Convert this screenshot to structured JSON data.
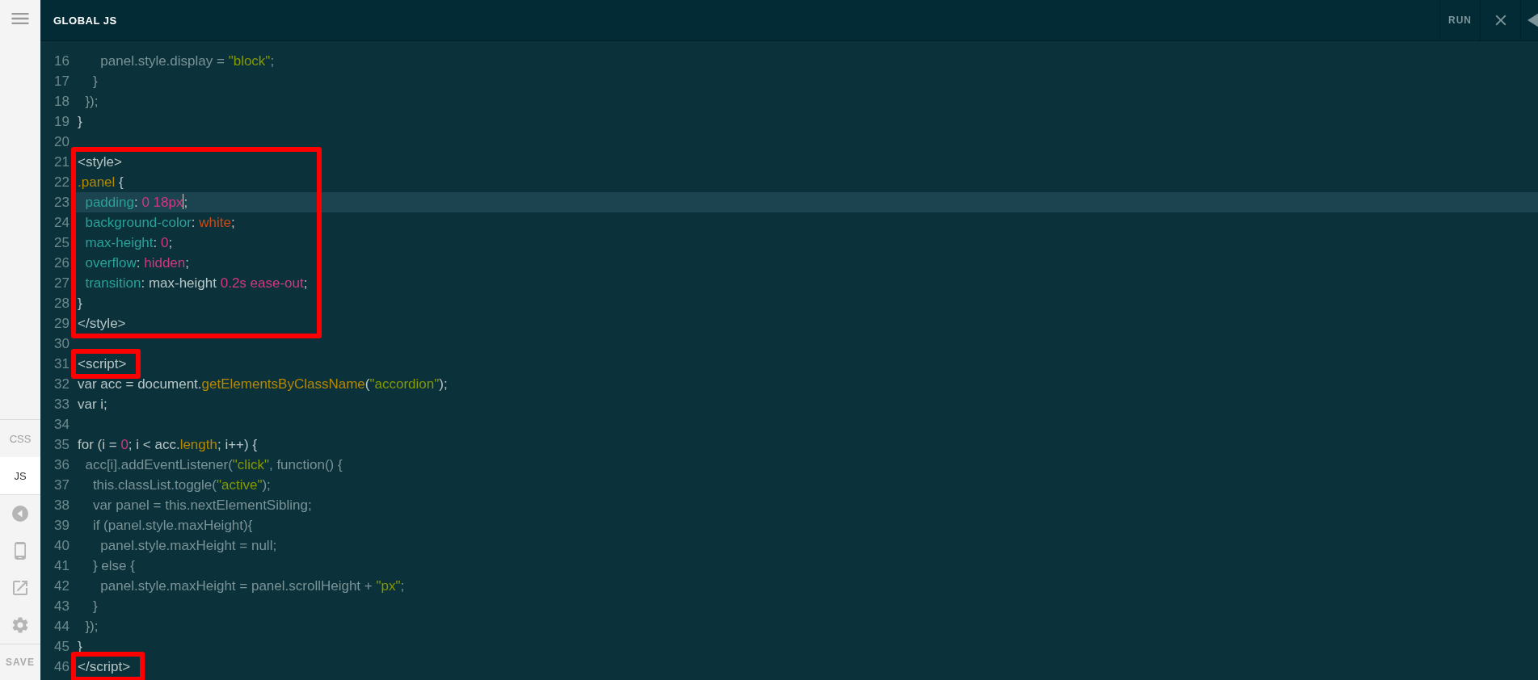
{
  "header": {
    "title": "GLOBAL JS",
    "run_label": "RUN"
  },
  "sidebar": {
    "tabs": [
      {
        "label": "CSS",
        "selected": false
      },
      {
        "label": "JS",
        "selected": true
      }
    ],
    "save_label": "SAVE"
  },
  "editor": {
    "blocks": [
      {
        "boxed": false,
        "lines": [
          {
            "number": "16",
            "active": false,
            "tokens": [
              {
                "t": "      panel.style.display = ",
                "kind": "dim"
              },
              {
                "t": "\"block\"",
                "kind": "string"
              },
              {
                "t": ";",
                "kind": "dim"
              }
            ]
          },
          {
            "number": "17",
            "active": false,
            "tokens": [
              {
                "t": "    }",
                "kind": "dim"
              }
            ]
          },
          {
            "number": "18",
            "active": false,
            "tokens": [
              {
                "t": "  });",
                "kind": "dim"
              }
            ]
          },
          {
            "number": "19",
            "active": false,
            "tokens": [
              {
                "t": "}",
                "kind": "light"
              }
            ]
          },
          {
            "number": "20",
            "active": false
          }
        ]
      },
      {
        "boxed": true,
        "lines": [
          {
            "number": "21",
            "active": false,
            "tokens": [
              {
                "t": "<style>",
                "kind": "light"
              }
            ]
          },
          {
            "number": "22",
            "active": false,
            "tokens": [
              {
                "t": ".panel",
                "kind": "func"
              },
              {
                "t": " {",
                "kind": "light"
              }
            ]
          },
          {
            "number": "23",
            "active": true,
            "tokens": [
              {
                "t": "  padding",
                "kind": "prop"
              },
              {
                "t": ": ",
                "kind": "light"
              },
              {
                "t": "0 18px",
                "kind": "value",
                "caret": true
              },
              {
                "t": ";",
                "kind": "light"
              }
            ]
          },
          {
            "number": "24",
            "active": false,
            "tokens": [
              {
                "t": "  background-color",
                "kind": "prop"
              },
              {
                "t": ": ",
                "kind": "light"
              },
              {
                "t": "white",
                "kind": "keyword"
              },
              {
                "t": ";",
                "kind": "light"
              }
            ]
          },
          {
            "number": "25",
            "active": false,
            "tokens": [
              {
                "t": "  max-height",
                "kind": "prop"
              },
              {
                "t": ": ",
                "kind": "light"
              },
              {
                "t": "0",
                "kind": "value"
              },
              {
                "t": ";",
                "kind": "light"
              }
            ]
          },
          {
            "number": "26",
            "active": false,
            "tokens": [
              {
                "t": "  overflow",
                "kind": "prop"
              },
              {
                "t": ": ",
                "kind": "light"
              },
              {
                "t": "hidden",
                "kind": "value"
              },
              {
                "t": ";",
                "kind": "light"
              }
            ]
          },
          {
            "number": "27",
            "active": false,
            "tokens": [
              {
                "t": "  transition",
                "kind": "prop"
              },
              {
                "t": ": max-height ",
                "kind": "light"
              },
              {
                "t": "0.2s ease-out",
                "kind": "value"
              },
              {
                "t": ";",
                "kind": "light"
              }
            ]
          },
          {
            "number": "28",
            "active": false,
            "tokens": [
              {
                "t": "}",
                "kind": "light"
              }
            ]
          },
          {
            "number": "29",
            "active": false,
            "tokens": [
              {
                "t": "</style>",
                "kind": "light"
              }
            ]
          }
        ]
      },
      {
        "boxed": false,
        "lines": [
          {
            "number": "30",
            "active": false
          }
        ]
      },
      {
        "boxed": true,
        "lines": [
          {
            "number": "31",
            "active": false,
            "tokens": [
              {
                "t": "<script>",
                "kind": "light"
              }
            ]
          }
        ]
      },
      {
        "boxed": false,
        "lines": [
          {
            "number": "32",
            "active": false,
            "tokens": [
              {
                "t": "var acc = document.",
                "kind": "light"
              },
              {
                "t": "getElementsByClassName",
                "kind": "func"
              },
              {
                "t": "(",
                "kind": "light"
              },
              {
                "t": "\"accordion\"",
                "kind": "string"
              },
              {
                "t": ");",
                "kind": "light"
              }
            ]
          },
          {
            "number": "33",
            "active": false,
            "tokens": [
              {
                "t": "var i;",
                "kind": "light"
              }
            ]
          },
          {
            "number": "34",
            "active": false
          },
          {
            "number": "35",
            "active": false,
            "tokens": [
              {
                "t": "for (i = ",
                "kind": "light"
              },
              {
                "t": "0",
                "kind": "value"
              },
              {
                "t": "; i < acc.",
                "kind": "light"
              },
              {
                "t": "length",
                "kind": "func"
              },
              {
                "t": "; i++) {",
                "kind": "light"
              }
            ]
          },
          {
            "number": "36",
            "active": false,
            "tokens": [
              {
                "t": "  acc[i].addEventListener(",
                "kind": "dim"
              },
              {
                "t": "\"click\"",
                "kind": "string"
              },
              {
                "t": ", function() {",
                "kind": "dim"
              }
            ]
          },
          {
            "number": "37",
            "active": false,
            "tokens": [
              {
                "t": "    this.classList.toggle(",
                "kind": "dim"
              },
              {
                "t": "\"active\"",
                "kind": "string"
              },
              {
                "t": ");",
                "kind": "dim"
              }
            ]
          },
          {
            "number": "38",
            "active": false,
            "tokens": [
              {
                "t": "    var panel = this.nextElementSibling;",
                "kind": "dim"
              }
            ]
          },
          {
            "number": "39",
            "active": false,
            "tokens": [
              {
                "t": "    if (panel.style.maxHeight){",
                "kind": "dim"
              }
            ]
          },
          {
            "number": "40",
            "active": false,
            "tokens": [
              {
                "t": "      panel.style.maxHeight = null;",
                "kind": "dim"
              }
            ]
          },
          {
            "number": "41",
            "active": false,
            "tokens": [
              {
                "t": "    } else {",
                "kind": "dim"
              }
            ]
          },
          {
            "number": "42",
            "active": false,
            "tokens": [
              {
                "t": "      panel.style.maxHeight = panel.scrollHeight + ",
                "kind": "dim"
              },
              {
                "t": "\"px\"",
                "kind": "string"
              },
              {
                "t": ";",
                "kind": "dim"
              }
            ]
          },
          {
            "number": "43",
            "active": false,
            "tokens": [
              {
                "t": "    }",
                "kind": "dim"
              }
            ]
          },
          {
            "number": "44",
            "active": false,
            "tokens": [
              {
                "t": "  });",
                "kind": "dim"
              }
            ]
          },
          {
            "number": "45",
            "active": false,
            "tokens": [
              {
                "t": "}",
                "kind": "light"
              }
            ]
          }
        ]
      },
      {
        "boxed": true,
        "lines": [
          {
            "number": "46",
            "active": false,
            "tokens": [
              {
                "t": "</script>",
                "kind": "light"
              }
            ]
          }
        ]
      }
    ]
  }
}
